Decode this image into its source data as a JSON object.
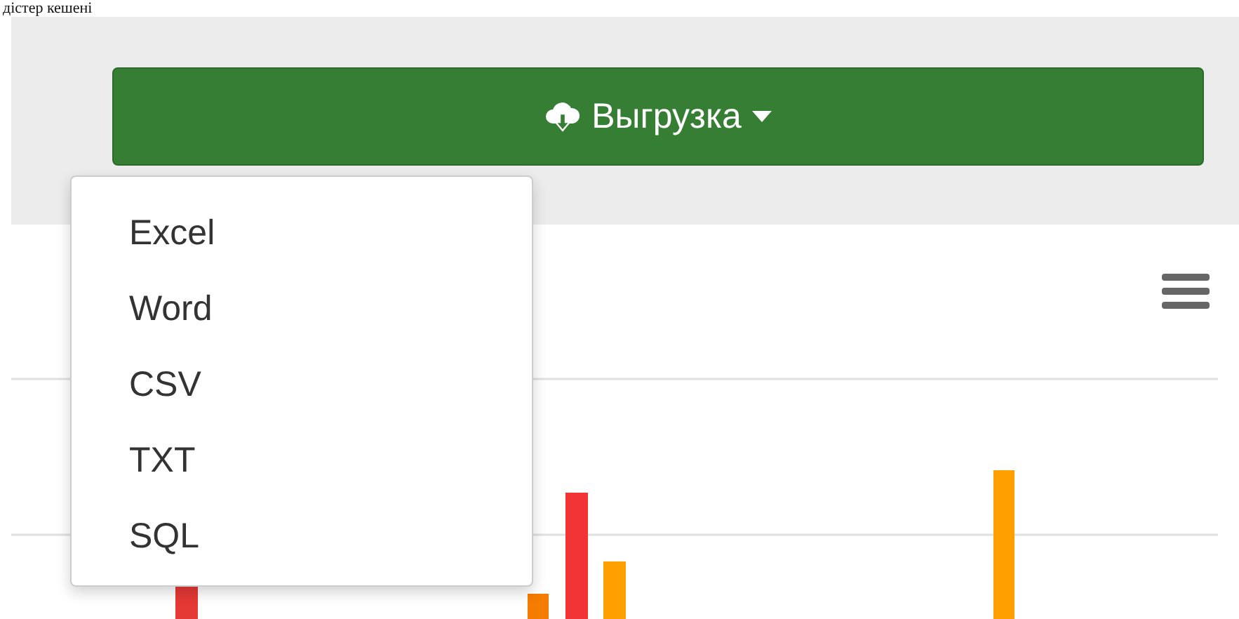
{
  "top_text": "дістер кешені",
  "export_button": {
    "label": "Выгрузка",
    "expanded": true
  },
  "export_menu": [
    {
      "label": "Excel"
    },
    {
      "label": "Word"
    },
    {
      "label": "CSV"
    },
    {
      "label": "TXT"
    },
    {
      "label": "SQL"
    }
  ]
}
